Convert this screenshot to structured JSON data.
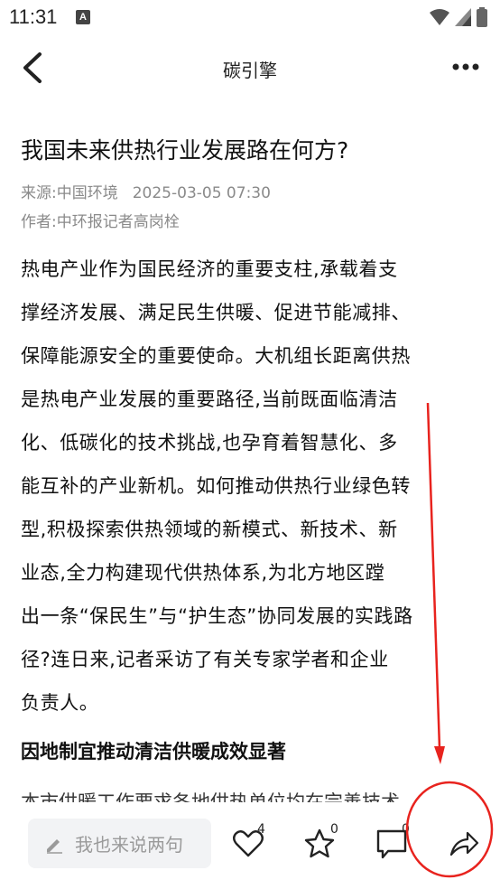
{
  "status_bar": {
    "time": "11:31",
    "notification_badge": "A"
  },
  "header": {
    "title": "碳引擎"
  },
  "article": {
    "title": "我国未来供热行业发展路在何方?",
    "source_line": "来源:中国环境",
    "date": "2025-03-05 07:30",
    "author_line": "作者:中环报记者高岗栓",
    "paragraph_lines": [
      "热电产业作为国民经济的重要支柱,承载着支",
      "撑经济发展、满足民生供暖、促进节能减排、",
      "保障能源安全的重要使命。大机组长距离供热",
      "是热电产业发展的重要路径,当前既面临清洁",
      "化、低碳化的技术挑战,也孕育着智慧化、多",
      "能互补的产业新机。如何推动供热行业绿色转",
      "型,积极探索供热领域的新模式、新技术、新",
      "业态,全力构建现代供热体系,为北方地区蹚",
      "出一条“保民生”与“护生态”协同发展的实践路",
      "径?连日来,记者采访了有关专家学者和企业",
      "负责人。"
    ],
    "subheading": "因地制宜推动清洁供暖成效显著",
    "cut_line": "本市供暖工作要求各地供热单位均在完善技术"
  },
  "bottom_bar": {
    "comment_placeholder": "我也来说两句",
    "like_count": "4",
    "favorite_count": "0",
    "comment_count": "0"
  },
  "colors": {
    "annotation": "#e8231e",
    "muted_text": "#8a8a8a",
    "comment_bg": "#f2f3f5"
  }
}
